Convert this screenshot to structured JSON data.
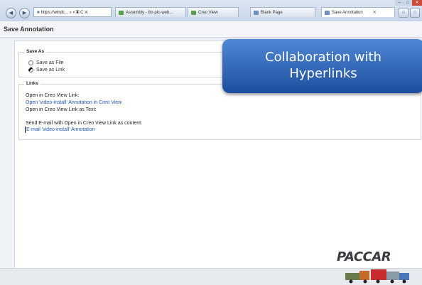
{
  "browser": {
    "address": "https://windc... ⌕ ▾ ▣ C ✕",
    "tabs": [
      {
        "label": "Assembly - btr-ptc-web...",
        "color": "#5aa04a"
      },
      {
        "label": "Creo View",
        "color": "#5aa04a"
      },
      {
        "label": "Blank Page",
        "color": "#6e8fc4"
      },
      {
        "label": "Save Annotation",
        "color": "#6e8fc4",
        "close": "✕"
      }
    ],
    "home_icon": "home-icon",
    "star_icon": "star-icon"
  },
  "page": {
    "title": "Save Annotation",
    "save_as": {
      "legend": "Save As",
      "options": [
        "Save as File",
        "Save as Link"
      ]
    },
    "links": {
      "legend": "Links",
      "open_label": "Open in Creo View Link:",
      "open_link": "Open 'video-install' Annotation in Creo View",
      "open_text_label": "Open in Creo View Link as Text:",
      "email_label": "Send E-mail with Open in Creo View Link as content:",
      "email_link": "E-mail 'video-install' Annotation"
    }
  },
  "overlay": {
    "line1": "Collaboration with",
    "line2": "Hyperlinks"
  },
  "branding": {
    "logo": "PACCAR"
  },
  "colors": {
    "link": "#1f56b7",
    "banner_top": "#4f89d6",
    "banner_bottom": "#1e4e9e"
  }
}
